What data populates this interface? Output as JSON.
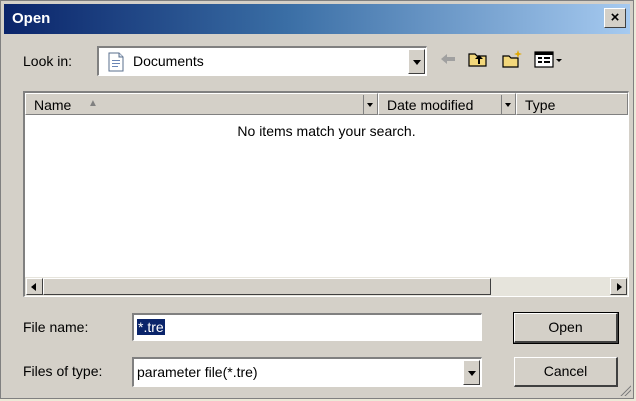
{
  "window": {
    "title": "Open",
    "close_glyph": "×"
  },
  "look_in": {
    "label": "Look in:",
    "value": "Documents",
    "icon": "documents-folder-icon"
  },
  "toolbar": {
    "back_icon": "back-arrow-icon",
    "up_icon": "up-one-level-icon",
    "new_folder_icon": "new-folder-icon",
    "view_menu_icon": "view-menu-icon"
  },
  "list": {
    "columns": [
      {
        "label": "Name",
        "sorted": "ascending"
      },
      {
        "label": "Date modified"
      },
      {
        "label": "Type"
      }
    ],
    "empty_message": "No items match your search."
  },
  "file_name": {
    "label": "File name:",
    "value": "*.tre"
  },
  "file_type": {
    "label": "Files of type:",
    "value": "parameter file(*.tre)"
  },
  "buttons": {
    "open": "Open",
    "cancel": "Cancel"
  },
  "colors": {
    "title_start": "#0a246a",
    "title_end": "#a6caf0",
    "face": "#d4d0c8",
    "selection": "#0a246a"
  }
}
